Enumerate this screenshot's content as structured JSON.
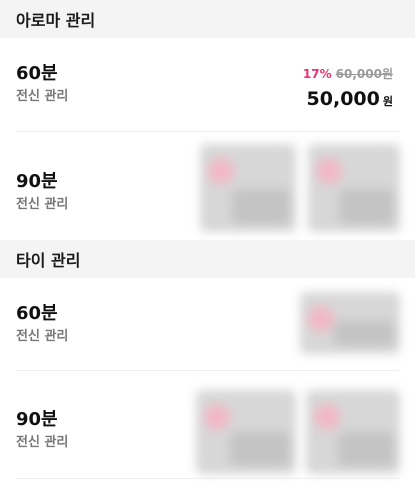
{
  "sections": [
    {
      "title": "아로마 관리",
      "items": [
        {
          "duration": "60분",
          "subtitle": "전신 관리",
          "discount": "17%",
          "original_price": "60,000원",
          "price": "50,000",
          "currency": "원"
        },
        {
          "duration": "90분",
          "subtitle": "전신 관리",
          "price_obscured": true
        }
      ]
    },
    {
      "title": "타이 관리",
      "items": [
        {
          "duration": "60분",
          "subtitle": "전신 관리",
          "price_obscured": true
        },
        {
          "duration": "90분",
          "subtitle": "전신 관리",
          "price_obscured": true
        }
      ]
    }
  ],
  "colors": {
    "header_bg": "#f4f4f4",
    "discount": "#e8336d",
    "muted": "#9a9a9a",
    "text": "#111111"
  }
}
